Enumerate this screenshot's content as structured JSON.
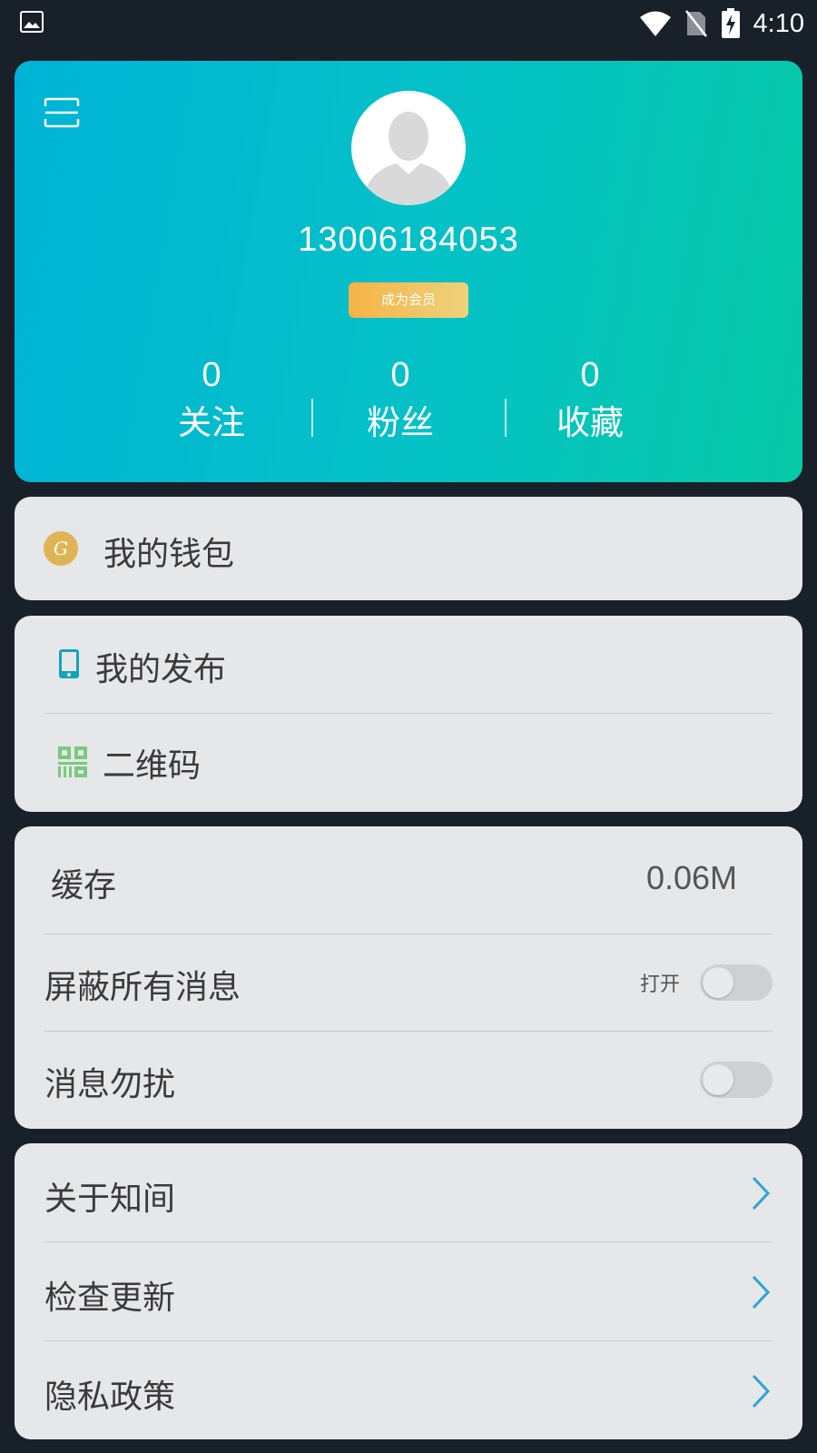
{
  "status_bar": {
    "time": "4:10",
    "icons": [
      "image-icon",
      "wifi-icon",
      "no-sim-icon",
      "battery-charging-icon"
    ]
  },
  "profile": {
    "phone": "13006184053",
    "member_button": "成为会员",
    "stats": [
      {
        "value": "0",
        "label": "关注"
      },
      {
        "value": "0",
        "label": "粉丝"
      },
      {
        "value": "0",
        "label": "收藏"
      }
    ]
  },
  "wallet": {
    "label": "我的钱包",
    "icon_letter": "G"
  },
  "menu_a": {
    "publish": "我的发布",
    "qrcode": "二维码"
  },
  "settings": {
    "cache_label": "缓存",
    "cache_value": "0.06M",
    "block_all_label": "屏蔽所有消息",
    "block_all_state": "打开",
    "dnd_label": "消息勿扰"
  },
  "about": {
    "about_label": "关于知间",
    "update_label": "检查更新",
    "privacy_label": "隐私政策"
  },
  "colors": {
    "accent_gradient_start": "#00b3d6",
    "accent_gradient_end": "#06c9a6",
    "member_gold": "#f5b347",
    "chevron_blue": "#2ea3d6",
    "card_bg": "#e6e7e9",
    "page_bg": "#182029"
  }
}
